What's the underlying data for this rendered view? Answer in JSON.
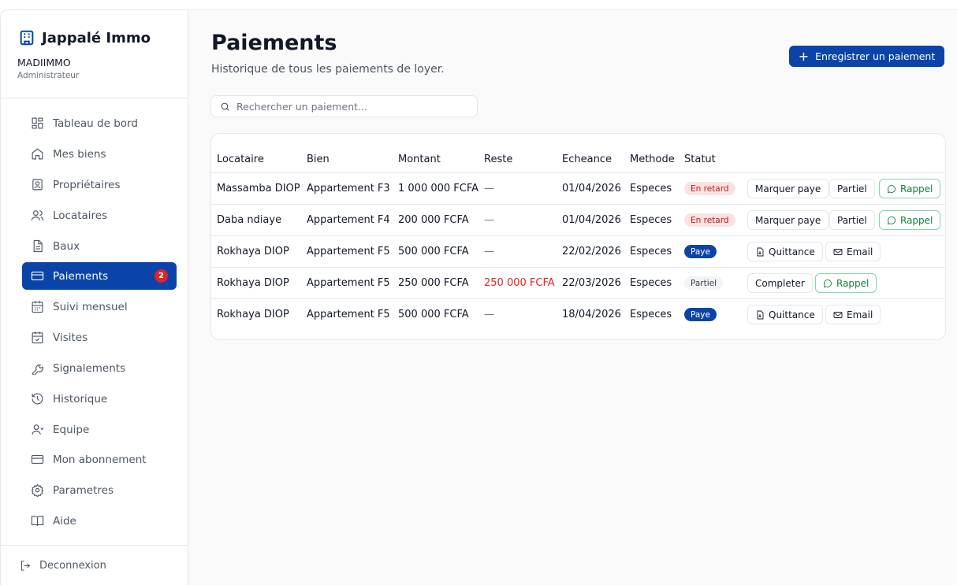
{
  "app": {
    "name": "Jappalé Immo",
    "org": "MADIIMMO",
    "role": "Administrateur"
  },
  "sidebar": {
    "items": [
      {
        "label": "Tableau de bord",
        "icon": "dashboard-icon"
      },
      {
        "label": "Mes biens",
        "icon": "home-icon"
      },
      {
        "label": "Propriétaires",
        "icon": "id-card-icon"
      },
      {
        "label": "Locataires",
        "icon": "users-icon"
      },
      {
        "label": "Baux",
        "icon": "document-icon"
      },
      {
        "label": "Paiements",
        "icon": "credit-card-icon",
        "active": true,
        "badge": "2"
      },
      {
        "label": "Suivi mensuel",
        "icon": "calendar-grid-icon"
      },
      {
        "label": "Visites",
        "icon": "calendar-check-icon"
      },
      {
        "label": "Signalements",
        "icon": "wrench-icon"
      },
      {
        "label": "Historique",
        "icon": "history-icon"
      },
      {
        "label": "Equipe",
        "icon": "team-icon"
      },
      {
        "label": "Mon abonnement",
        "icon": "card-icon"
      },
      {
        "label": "Parametres",
        "icon": "gear-icon"
      },
      {
        "label": "Aide",
        "icon": "book-icon"
      }
    ],
    "logout": "Deconnexion"
  },
  "header": {
    "title": "Paiements",
    "subtitle": "Historique de tous les paiements de loyer.",
    "primary_button": "Enregistrer un paiement"
  },
  "search": {
    "placeholder": "Rechercher un paiement..."
  },
  "table": {
    "columns": [
      "Locataire",
      "Bien",
      "Montant",
      "Reste",
      "Echeance",
      "Methode",
      "Statut"
    ],
    "rows": [
      {
        "locataire": "Massamba DIOP",
        "bien": "Appartement F3",
        "montant": "1 000 000 FCFA",
        "reste": "—",
        "echeance": "01/04/2026",
        "methode": "Especes",
        "statut": "En retard",
        "actions": [
          "Marquer paye",
          "Partiel",
          "Rappel"
        ]
      },
      {
        "locataire": "Daba ndiaye",
        "bien": "Appartement F4",
        "montant": "200 000 FCFA",
        "reste": "—",
        "echeance": "01/04/2026",
        "methode": "Especes",
        "statut": "En retard",
        "actions": [
          "Marquer paye",
          "Partiel",
          "Rappel"
        ]
      },
      {
        "locataire": "Rokhaya DIOP",
        "bien": "Appartement F5",
        "montant": "500 000 FCFA",
        "reste": "—",
        "echeance": "22/02/2026",
        "methode": "Especes",
        "statut": "Paye",
        "actions": [
          "Quittance",
          "Email"
        ]
      },
      {
        "locataire": "Rokhaya DIOP",
        "bien": "Appartement F5",
        "montant": "250 000 FCFA",
        "reste": "250 000 FCFA",
        "echeance": "22/03/2026",
        "methode": "Especes",
        "statut": "Partiel",
        "actions": [
          "Completer",
          "Rappel"
        ]
      },
      {
        "locataire": "Rokhaya DIOP",
        "bien": "Appartement F5",
        "montant": "500 000 FCFA",
        "reste": "—",
        "echeance": "18/04/2026",
        "methode": "Especes",
        "statut": "Paye",
        "actions": [
          "Quittance",
          "Email"
        ]
      }
    ]
  },
  "colors": {
    "primary": "#0b44a8",
    "danger": "#dc2626",
    "late_bg": "#fde2e2",
    "success": "#15803d"
  }
}
